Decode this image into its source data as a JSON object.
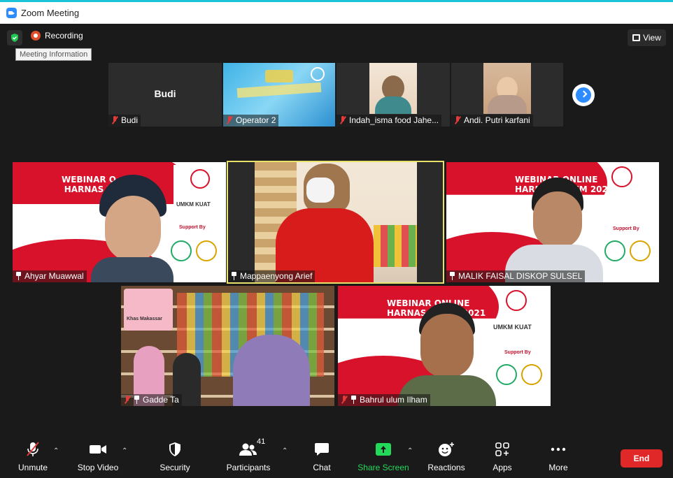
{
  "window": {
    "title": "Zoom Meeting"
  },
  "header": {
    "recording_label": "Recording",
    "tooltip": "Meeting Information",
    "view_label": "View"
  },
  "gallery_top": [
    {
      "name": "Budi",
      "display_text": "Budi",
      "muted": true
    },
    {
      "name": "Operator 2",
      "muted": true
    },
    {
      "name": "Indah_isma food Jahe...",
      "muted": true
    },
    {
      "name": "Andi. Putri karfani",
      "muted": true
    }
  ],
  "gallery_main": [
    {
      "name": "Ahyar Muawwal",
      "muted": false
    },
    {
      "name": "Mappaenyong Arief",
      "muted": false,
      "active_speaker": true
    },
    {
      "name": "MALIK FAISAL DISKOP SULSEL",
      "muted": false
    },
    {
      "name": "Gadde Ta",
      "muted": true
    },
    {
      "name": "Bahrul ulum Ilham",
      "muted": true
    }
  ],
  "webinar_text": {
    "title_1": "WEBINAR O",
    "title_1b": "HARNAS U",
    "title_2": "WEBINAR ONLINE",
    "title_2b": "HARNAS UMKM 2021",
    "title_3": "WEBINAR ONLINE",
    "title_3b": "HARNAS UMKM 2021",
    "support": "Support By",
    "umkm": "UMKM KUAT",
    "store_sign": "Khas Makassar"
  },
  "toolbar": {
    "unmute": "Unmute",
    "stop_video": "Stop Video",
    "security": "Security",
    "participants": "Participants",
    "participants_count": "41",
    "chat": "Chat",
    "share_screen": "Share Screen",
    "reactions": "Reactions",
    "apps": "Apps",
    "more": "More",
    "end": "End"
  },
  "colors": {
    "accent_blue": "#2d8cff",
    "share_green": "#23d959",
    "end_red": "#e02828",
    "active_speaker_border": "#e8e26a",
    "banner_red": "#d8122a"
  }
}
